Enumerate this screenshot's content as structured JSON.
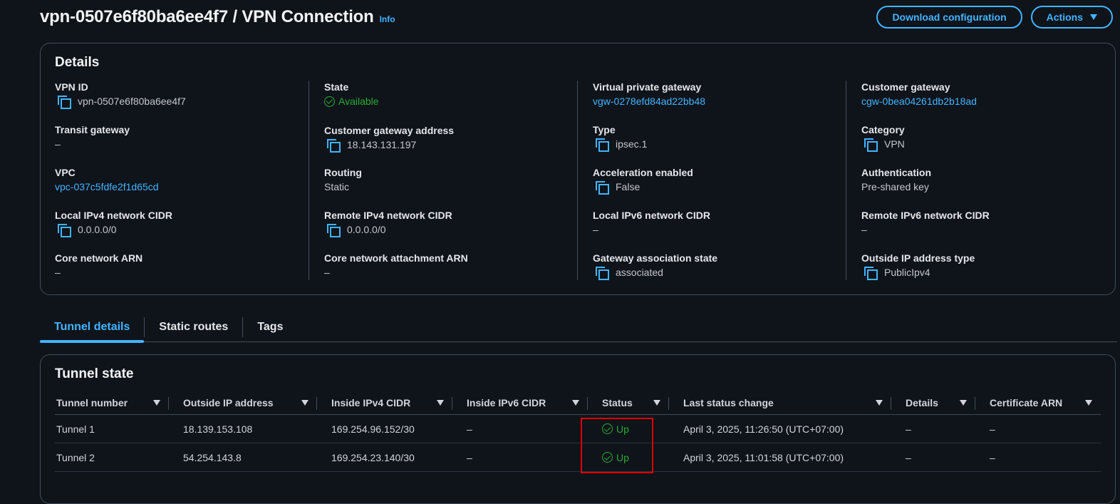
{
  "header": {
    "title": "vpn-0507e6f80ba6ee4f7 / VPN Connection",
    "info": "Info",
    "download_label": "Download configuration",
    "actions_label": "Actions"
  },
  "details": {
    "title": "Details",
    "columns": [
      [
        {
          "label": "VPN ID",
          "value": "vpn-0507e6f80ba6ee4f7",
          "copy": true
        },
        {
          "label": "Transit gateway",
          "value": "–"
        },
        {
          "label": "VPC",
          "value": "vpc-037c5fdfe2f1d65cd",
          "link": true
        },
        {
          "label": "Local IPv4 network CIDR",
          "value": "0.0.0.0/0",
          "copy": true
        },
        {
          "label": "Core network ARN",
          "value": "–"
        }
      ],
      [
        {
          "label": "State",
          "value": "Available",
          "status": true
        },
        {
          "label": "Customer gateway address",
          "value": "18.143.131.197",
          "copy": true
        },
        {
          "label": "Routing",
          "value": "Static"
        },
        {
          "label": "Remote IPv4 network CIDR",
          "value": "0.0.0.0/0",
          "copy": true
        },
        {
          "label": "Core network attachment ARN",
          "value": "–"
        }
      ],
      [
        {
          "label": "Virtual private gateway",
          "value": "vgw-0278efd84ad22bb48",
          "link": true
        },
        {
          "label": "Type",
          "value": "ipsec.1",
          "copy": true
        },
        {
          "label": "Acceleration enabled",
          "value": "False",
          "copy": true
        },
        {
          "label": "Local IPv6 network CIDR",
          "value": "–"
        },
        {
          "label": "Gateway association state",
          "value": "associated",
          "copy": true
        }
      ],
      [
        {
          "label": "Customer gateway",
          "value": "cgw-0bea04261db2b18ad",
          "link": true
        },
        {
          "label": "Category",
          "value": "VPN",
          "copy": true
        },
        {
          "label": "Authentication",
          "value": "Pre-shared key"
        },
        {
          "label": "Remote IPv6 network CIDR",
          "value": "–"
        },
        {
          "label": "Outside IP address type",
          "value": "PublicIpv4",
          "copy": true
        }
      ]
    ]
  },
  "tabs": [
    {
      "label": "Tunnel details",
      "active": true
    },
    {
      "label": "Static routes",
      "active": false
    },
    {
      "label": "Tags",
      "active": false
    }
  ],
  "tunnel_state": {
    "title": "Tunnel state",
    "headers": [
      "Tunnel number",
      "Outside IP address",
      "Inside IPv4 CIDR",
      "Inside IPv6 CIDR",
      "Status",
      "Last status change",
      "Details",
      "Certificate ARN"
    ],
    "rows": [
      [
        "Tunnel 1",
        "18.139.153.108",
        "169.254.96.152/30",
        "–",
        "Up",
        "April 3, 2025, 11:26:50 (UTC+07:00)",
        "–",
        "–"
      ],
      [
        "Tunnel 2",
        "54.254.143.8",
        "169.254.23.140/30",
        "–",
        "Up",
        "April 3, 2025, 11:01:58 (UTC+07:00)",
        "–",
        "–"
      ]
    ]
  },
  "colors": {
    "background": "#0f141a",
    "accent": "#42b4ff",
    "success": "#29ad32",
    "highlight_border": "#e00000"
  }
}
